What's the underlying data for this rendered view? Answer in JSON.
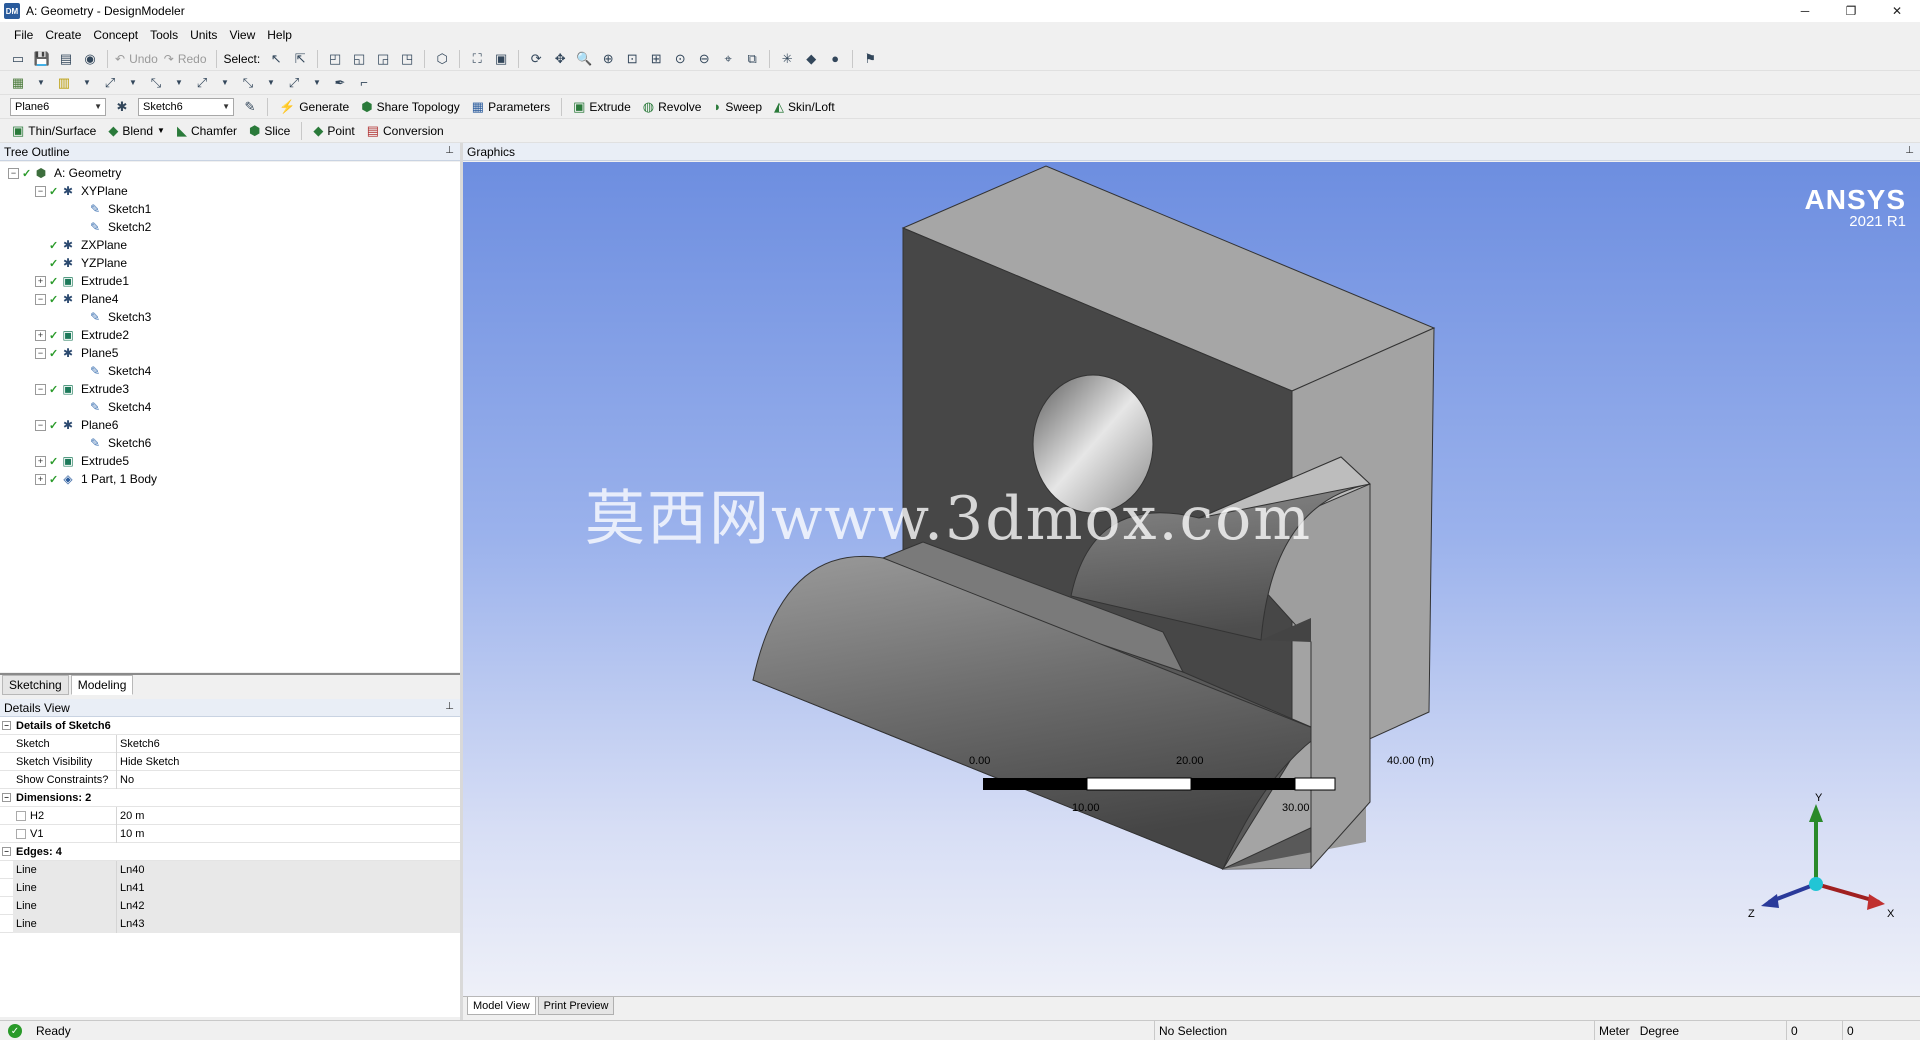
{
  "window": {
    "app_icon": "DM",
    "title": "A: Geometry - DesignModeler",
    "controls": [
      "─",
      "❐",
      "✕"
    ]
  },
  "menu": [
    "File",
    "Create",
    "Concept",
    "Tools",
    "Units",
    "View",
    "Help"
  ],
  "toolbar1": {
    "undo_label": "Undo",
    "redo_label": "Redo",
    "select_label": "Select:"
  },
  "toolbar3": {
    "plane_value": "Plane6",
    "sketch_value": "Sketch6",
    "generate_label": "Generate",
    "share_topology_label": "Share Topology",
    "parameters_label": "Parameters",
    "extrude_label": "Extrude",
    "revolve_label": "Revolve",
    "sweep_label": "Sweep",
    "skinloft_label": "Skin/Loft"
  },
  "toolbar4": {
    "thin_surface_label": "Thin/Surface",
    "blend_label": "Blend",
    "chamfer_label": "Chamfer",
    "slice_label": "Slice",
    "point_label": "Point",
    "conversion_label": "Conversion"
  },
  "tree": {
    "header": "Tree Outline",
    "items": [
      {
        "label": "A: Geometry",
        "level": 0,
        "expander": "−",
        "icon": "geometry-icon",
        "glyph": "⬢",
        "cls": "geom",
        "checked": true
      },
      {
        "label": "XYPlane",
        "level": 1,
        "expander": "−",
        "icon": "plane-icon",
        "glyph": "✱",
        "cls": "plane",
        "checked": true
      },
      {
        "label": "Sketch1",
        "level": 2,
        "expander": "",
        "icon": "sketch-icon",
        "glyph": "✎",
        "cls": "sketch",
        "checked": false
      },
      {
        "label": "Sketch2",
        "level": 2,
        "expander": "",
        "icon": "sketch-icon",
        "glyph": "✎",
        "cls": "sketch",
        "checked": false
      },
      {
        "label": "ZXPlane",
        "level": 1,
        "expander": "",
        "icon": "plane-icon",
        "glyph": "✱",
        "cls": "plane",
        "checked": true
      },
      {
        "label": "YZPlane",
        "level": 1,
        "expander": "",
        "icon": "plane-icon",
        "glyph": "✱",
        "cls": "plane",
        "checked": true
      },
      {
        "label": "Extrude1",
        "level": 1,
        "expander": "+",
        "icon": "extrude-icon",
        "glyph": "▣",
        "cls": "feat",
        "checked": true
      },
      {
        "label": "Plane4",
        "level": 1,
        "expander": "−",
        "icon": "plane-icon",
        "glyph": "✱",
        "cls": "plane",
        "checked": true
      },
      {
        "label": "Sketch3",
        "level": 2,
        "expander": "",
        "icon": "sketch-icon",
        "glyph": "✎",
        "cls": "sketch",
        "checked": false
      },
      {
        "label": "Extrude2",
        "level": 1,
        "expander": "+",
        "icon": "extrude-icon",
        "glyph": "▣",
        "cls": "feat",
        "checked": true
      },
      {
        "label": "Plane5",
        "level": 1,
        "expander": "−",
        "icon": "plane-icon",
        "glyph": "✱",
        "cls": "plane",
        "checked": true
      },
      {
        "label": "Sketch4",
        "level": 2,
        "expander": "",
        "icon": "sketch-icon",
        "glyph": "✎",
        "cls": "sketch",
        "checked": false
      },
      {
        "label": "Extrude3",
        "level": 1,
        "expander": "−",
        "icon": "extrude-icon",
        "glyph": "▣",
        "cls": "feat",
        "checked": true
      },
      {
        "label": "Sketch4",
        "level": 2,
        "expander": "",
        "icon": "sketch-icon",
        "glyph": "✎",
        "cls": "sketch",
        "checked": false
      },
      {
        "label": "Plane6",
        "level": 1,
        "expander": "−",
        "icon": "plane-icon",
        "glyph": "✱",
        "cls": "plane",
        "checked": true
      },
      {
        "label": "Sketch6",
        "level": 2,
        "expander": "",
        "icon": "sketch-icon",
        "glyph": "✎",
        "cls": "sketch",
        "checked": false
      },
      {
        "label": "Extrude5",
        "level": 1,
        "expander": "+",
        "icon": "extrude-icon",
        "glyph": "▣",
        "cls": "feat",
        "checked": true
      },
      {
        "label": "1 Part, 1 Body",
        "level": 1,
        "expander": "+",
        "icon": "part-icon",
        "glyph": "◈",
        "cls": "part",
        "checked": true
      }
    ]
  },
  "tabs": {
    "sketching": "Sketching",
    "modeling": "Modeling"
  },
  "details": {
    "header": "Details View",
    "section_main": "Details of Sketch6",
    "rows_main": [
      {
        "label": "Sketch",
        "value": "Sketch6"
      },
      {
        "label": "Sketch Visibility",
        "value": "Hide Sketch"
      },
      {
        "label": "Show Constraints?",
        "value": "No"
      }
    ],
    "section_dims": "Dimensions: 2",
    "rows_dims": [
      {
        "label": "H2",
        "value": "20 m"
      },
      {
        "label": "V1",
        "value": "10 m"
      }
    ],
    "section_edges": "Edges: 4",
    "rows_edges": [
      {
        "label": "Line",
        "value": "Ln40"
      },
      {
        "label": "Line",
        "value": "Ln41"
      },
      {
        "label": "Line",
        "value": "Ln42"
      },
      {
        "label": "Line",
        "value": "Ln43"
      }
    ]
  },
  "graphics": {
    "header": "Graphics",
    "logo_line1": "ANSYS",
    "logo_line2": "2021 R1",
    "watermark": "莫西网www.3dmox.com",
    "scale_labels_top": [
      "0.00",
      "20.00",
      "40.00 (m)"
    ],
    "scale_labels_bottom": [
      "10.00",
      "30.00"
    ],
    "axis_x": "X",
    "axis_y": "Y",
    "axis_z": "Z",
    "tab_model": "Model View",
    "tab_print": "Print Preview"
  },
  "status": {
    "ready": "Ready",
    "selection": "No Selection",
    "length_unit": "Meter",
    "angle_unit": "Degree",
    "field1": "0",
    "field2": "0"
  }
}
